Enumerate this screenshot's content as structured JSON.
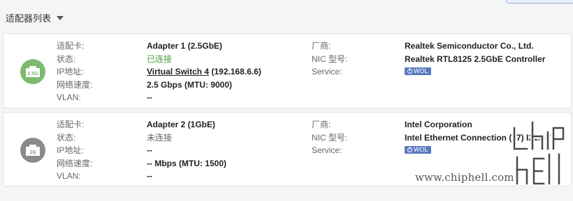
{
  "header": {
    "title": "适配器列表",
    "dropdown_icon": "caret-down-icon"
  },
  "labels": {
    "adapter": "适配卡:",
    "status": "状态:",
    "ip": "IP地址:",
    "speed": "网络速度:",
    "vlan": "VLAN:",
    "vendor": "厂商:",
    "nic_model": "NIC 型号:",
    "service": "Service:"
  },
  "adapters": [
    {
      "icon": "ethernet-port-icon",
      "icon_label": "2.5G",
      "icon_color": "#7dba6f",
      "name": "Adapter 1 (2.5GbE)",
      "status": "已连接",
      "status_color": "#4a9e3a",
      "ip_link": "Virtual Switch 4",
      "ip_address": "(192.168.6.6)",
      "speed": "2.5 Gbps (MTU: 9000)",
      "vlan": "--",
      "vendor": "Realtek Semiconductor Co., Ltd.",
      "nic_model": "Realtek RTL8125 2.5GbE Controller",
      "service_badge": "WOL"
    },
    {
      "icon": "ethernet-port-icon",
      "icon_label": "1G",
      "icon_color": "#8a8a8a",
      "name": "Adapter 2 (1GbE)",
      "status": "未连接",
      "status_color": "#666666",
      "ip_link": "",
      "ip_address": "--",
      "speed": "-- Mbps (MTU: 1500)",
      "vlan": "--",
      "vendor": "Intel Corporation",
      "nic_model": "Intel Ethernet Connection (17) I219-V",
      "service_badge": "WOL"
    }
  ],
  "watermark": {
    "text": "www.chiphell.com",
    "logo": "chiphell"
  }
}
